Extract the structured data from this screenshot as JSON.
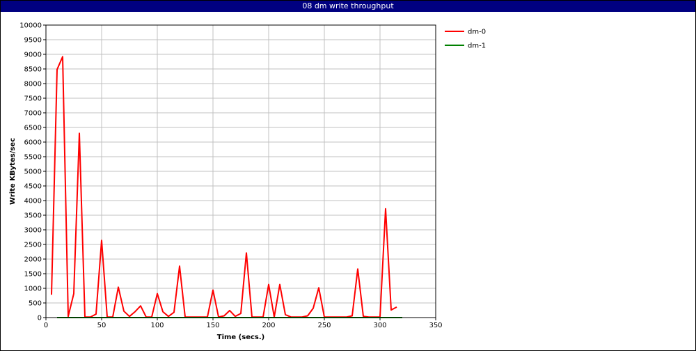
{
  "window": {
    "title": "08 dm write throughput"
  },
  "colors": {
    "title_bar": "#000080",
    "grid": "#c0c0c0",
    "axis": "#000000"
  },
  "chart_data": {
    "type": "line",
    "title": "08 dm write throughput",
    "xlabel": "Time (secs.)",
    "ylabel": "Write KBytes/sec",
    "xlim": [
      0,
      350
    ],
    "ylim": [
      0,
      10000
    ],
    "xticks": [
      0,
      50,
      100,
      150,
      200,
      250,
      300,
      350
    ],
    "yticks": [
      0,
      500,
      1000,
      1500,
      2000,
      2500,
      3000,
      3500,
      4000,
      4500,
      5000,
      5500,
      6000,
      6500,
      7000,
      7500,
      8000,
      8500,
      9000,
      9500,
      10000
    ],
    "grid": true,
    "legend_position": "top-right",
    "series": [
      {
        "name": "dm-0",
        "color": "#ff0000",
        "x": [
          5,
          10,
          15,
          20,
          25,
          30,
          35,
          40,
          45,
          50,
          55,
          60,
          65,
          70,
          75,
          80,
          85,
          90,
          95,
          100,
          105,
          110,
          115,
          120,
          125,
          130,
          135,
          140,
          145,
          150,
          155,
          160,
          165,
          170,
          175,
          180,
          185,
          190,
          195,
          200,
          205,
          210,
          215,
          220,
          225,
          230,
          235,
          240,
          245,
          250,
          255,
          260,
          265,
          270,
          275,
          280,
          285,
          290,
          295,
          300,
          305,
          310,
          315
        ],
        "values": [
          780,
          8480,
          8920,
          40,
          820,
          6300,
          20,
          20,
          120,
          2640,
          20,
          20,
          1040,
          220,
          40,
          200,
          400,
          20,
          20,
          820,
          200,
          40,
          180,
          1760,
          20,
          20,
          20,
          20,
          20,
          940,
          20,
          60,
          240,
          40,
          140,
          2210,
          20,
          20,
          20,
          1130,
          20,
          1130,
          100,
          20,
          20,
          20,
          60,
          320,
          1020,
          20,
          20,
          20,
          20,
          20,
          60,
          1660,
          40,
          20,
          20,
          20,
          3720,
          260,
          360
        ]
      },
      {
        "name": "dm-1",
        "color": "#008000",
        "x": [
          10,
          320
        ],
        "values": [
          0,
          0
        ]
      }
    ]
  }
}
